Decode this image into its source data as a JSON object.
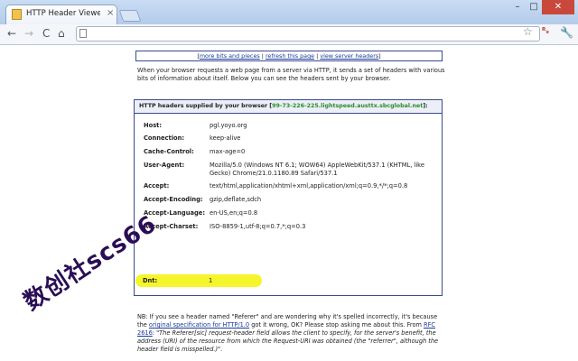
{
  "browser": {
    "tab_title": "HTTP Header Viewer: list b",
    "tab_close": "×",
    "window_min": "–",
    "window_max": "□",
    "window_close": "✕",
    "url": "",
    "nav_back": "←",
    "nav_forward": "→",
    "nav_reload": "C",
    "nav_home": "⌂",
    "star": "☆",
    "extension": "ᴿₓ",
    "wrench": "🔧"
  },
  "links": {
    "open": "[",
    "more": "more bits and pieces",
    "sep1": " | ",
    "refresh": "refresh this page",
    "sep2": " | ",
    "view": "view server headers",
    "close": "]"
  },
  "intro": "When your browser requests a web page from a server via HTTP, it sends a set of headers with various bits of information about itself. Below you can see the headers sent by your browser.",
  "panel": {
    "title": "HTTP headers supplied by your browser [",
    "ip": "99-73-226-225.lightspeed.austtx.sbcglobal.net",
    "title_end": "]:"
  },
  "headers": [
    {
      "name": "Host:",
      "value": "pgl.yoyo.org"
    },
    {
      "name": "Connection:",
      "value": "keep-alive"
    },
    {
      "name": "Cache-Control:",
      "value": "max-age=0"
    },
    {
      "name": "User-Agent:",
      "value": "Mozilla/5.0 (Windows NT 6.1; WOW64) AppleWebKit/537.1 (KHTML, like Gecko) Chrome/21.0.1180.89 Safari/537.1"
    },
    {
      "name": "Accept:",
      "value": "text/html,application/xhtml+xml,application/xml;q=0.9,*/*;q=0.8"
    },
    {
      "name": "Accept-Encoding:",
      "value": "gzip,deflate,sdch"
    },
    {
      "name": "Accept-Language:",
      "value": "en-US,en;q=0.8"
    },
    {
      "name": "Accept-Charset:",
      "value": "ISO-8859-1,utf-8;q=0.7,*;q=0.3"
    },
    {
      "name": "Dnt:",
      "value": "1"
    }
  ],
  "nb": {
    "p1": "NB: If you see a header named \"Referer\" and are wondering why it's spelled incorrectly, it's because the ",
    "link1": "original specification for HTTP/1.0",
    "p2": " got it wrong, OK? Please stop asking me about this. From ",
    "link2": "RFC 2616",
    "p3": ": ",
    "quote": "\"The Referer[sic] request-header field allows the client to specify, for the server's benefit, the address (URI) of the resource from which the Request-URI was obtained (the \"referrer\", although the header field is misspelled.)\"",
    "end": "."
  },
  "watermark": "数创社scs66"
}
